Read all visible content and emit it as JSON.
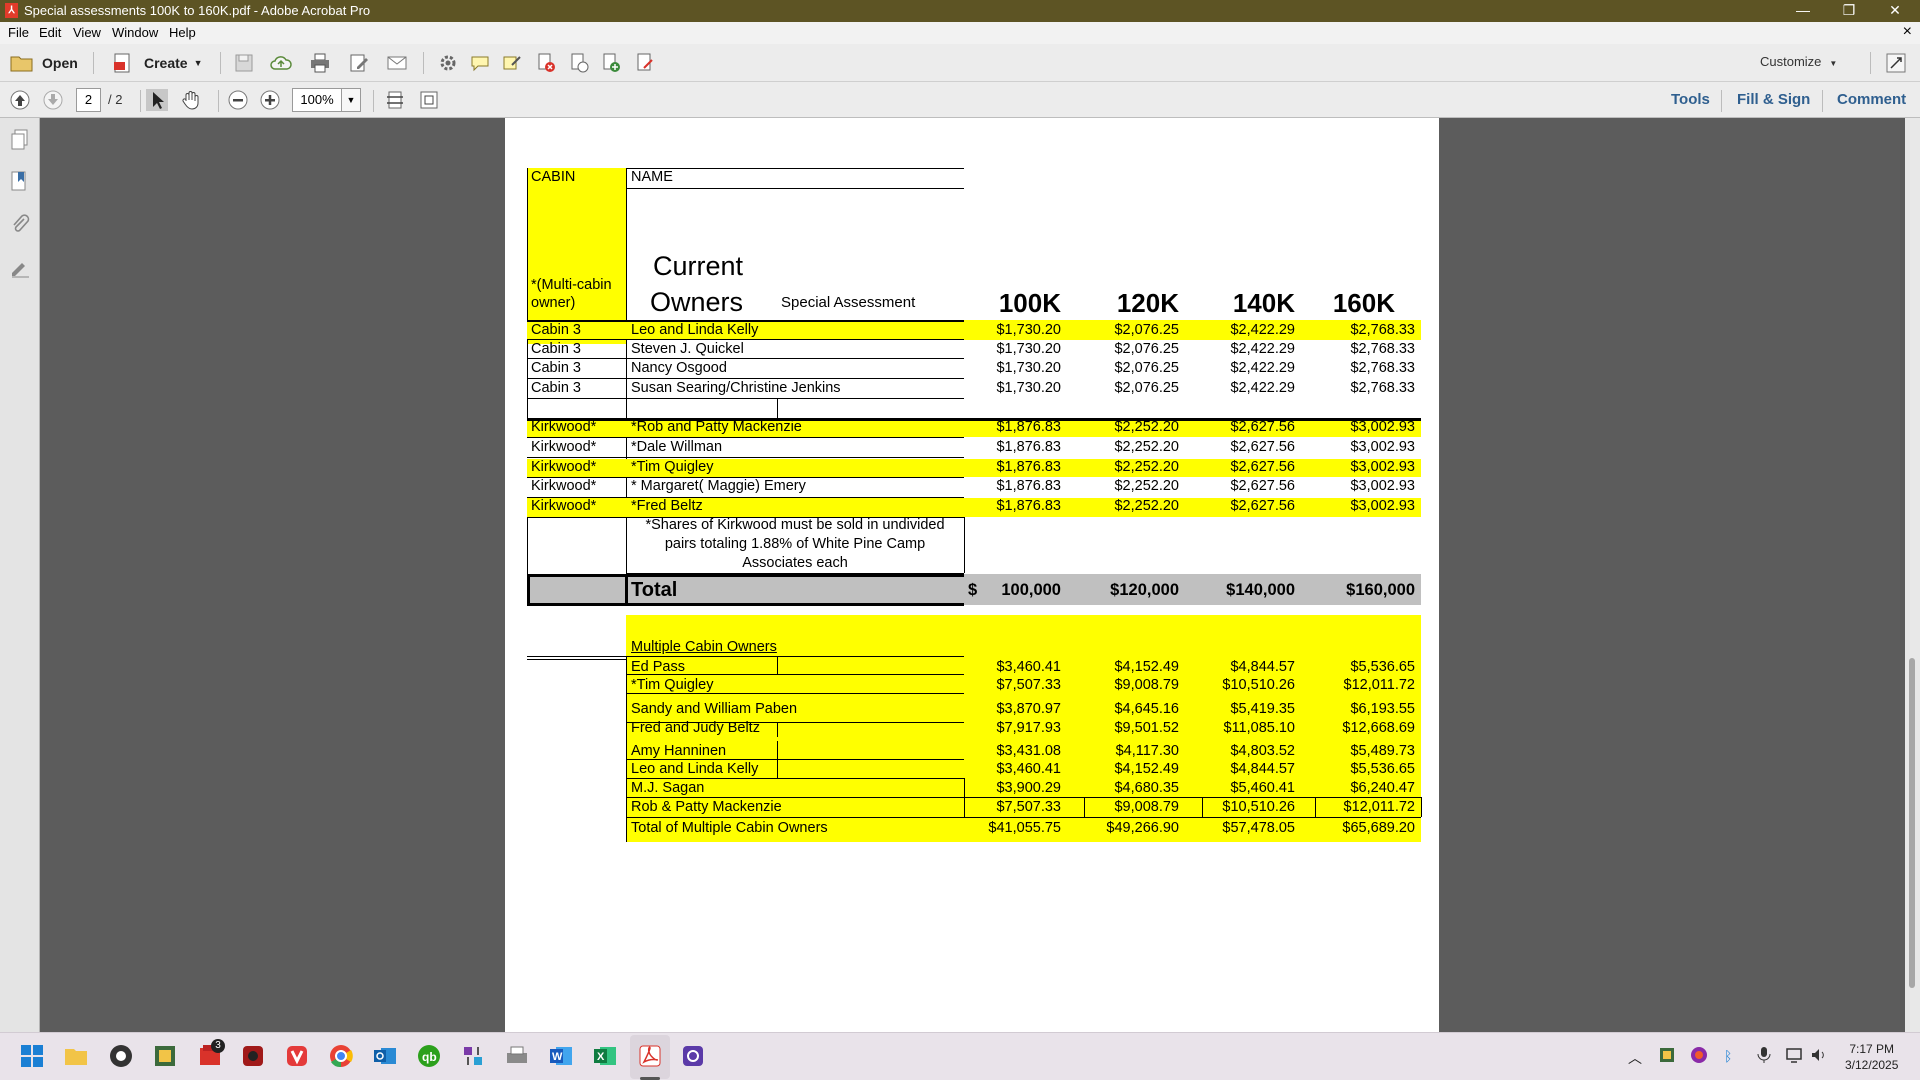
{
  "window": {
    "title": "Special assessments 100K to 160K.pdf - Adobe Acrobat Pro",
    "app_icon": "acrobat-icon",
    "controls": {
      "minimize": "—",
      "restore": "❐",
      "close": "✕"
    }
  },
  "menu": {
    "items": [
      "File",
      "Edit",
      "View",
      "Window",
      "Help"
    ],
    "close_doc": "×"
  },
  "toolbar": {
    "open_label": "Open",
    "create_label": "Create",
    "customize_label": "Customize"
  },
  "nav": {
    "current_page": "2",
    "page_count": "/ 2",
    "zoom": "100%",
    "tools_label": "Tools",
    "fill_sign_label": "Fill & Sign",
    "comment_label": "Comment"
  },
  "sheet": {
    "hdr_cabin": "CABIN",
    "hdr_name": "NAME",
    "multi_note_1": "*(Multi-cabin",
    "multi_note_2": "owner)",
    "current_1": "Current",
    "current_2": "Owners",
    "special_assessment": "Special Assessment",
    "columns": [
      "100K",
      "120K",
      "140K",
      "160K"
    ],
    "cabin3_rows": [
      {
        "cabin": "Cabin 3",
        "name": "Leo and Linda Kelly",
        "v": [
          "$1,730.20",
          "$2,076.25",
          "$2,422.29",
          "$2,768.33"
        ]
      },
      {
        "cabin": "Cabin 3",
        "name": "Steven J. Quickel",
        "v": [
          "$1,730.20",
          "$2,076.25",
          "$2,422.29",
          "$2,768.33"
        ]
      },
      {
        "cabin": "Cabin 3",
        "name": "Nancy Osgood",
        "v": [
          "$1,730.20",
          "$2,076.25",
          "$2,422.29",
          "$2,768.33"
        ]
      },
      {
        "cabin": "Cabin 3",
        "name": "Susan Searing/Christine Jenkins",
        "v": [
          "$1,730.20",
          "$2,076.25",
          "$2,422.29",
          "$2,768.33"
        ]
      }
    ],
    "kirkwood_rows": [
      {
        "cabin": "Kirkwood*",
        "name": "*Rob and Patty Mackenzie",
        "v": [
          "$1,876.83",
          "$2,252.20",
          "$2,627.56",
          "$3,002.93"
        ]
      },
      {
        "cabin": "Kirkwood*",
        "name": "*Dale Willman",
        "v": [
          "$1,876.83",
          "$2,252.20",
          "$2,627.56",
          "$3,002.93"
        ]
      },
      {
        "cabin": "Kirkwood*",
        "name": "*Tim Quigley",
        "v": [
          "$1,876.83",
          "$2,252.20",
          "$2,627.56",
          "$3,002.93"
        ]
      },
      {
        "cabin": "Kirkwood*",
        "name": "* Margaret( Maggie)  Emery",
        "v": [
          "$1,876.83",
          "$2,252.20",
          "$2,627.56",
          "$3,002.93"
        ]
      },
      {
        "cabin": "Kirkwood*",
        "name": "*Fred Beltz",
        "v": [
          "$1,876.83",
          "$2,252.20",
          "$2,627.56",
          "$3,002.93"
        ]
      }
    ],
    "kirkwood_note": [
      "*Shares of Kirkwood must be sold in undivided",
      "pairs totaling 1.88% of White Pine Camp",
      "Associates each"
    ],
    "total_label": "Total",
    "total_dollar": "$",
    "totals": [
      "100,000",
      "$120,000",
      "$140,000",
      "$160,000"
    ],
    "multi_title": "Multiple Cabin Owners",
    "multi_rows": [
      {
        "name": "Ed Pass",
        "v": [
          "$3,460.41",
          "$4,152.49",
          "$4,844.57",
          "$5,536.65"
        ]
      },
      {
        "name": "*Tim Quigley",
        "v": [
          "$7,507.33",
          "$9,008.79",
          "$10,510.26",
          "$12,011.72"
        ]
      },
      {
        "name": "Sandy and William Paben",
        "v": [
          "$3,870.97",
          "$4,645.16",
          "$5,419.35",
          "$6,193.55"
        ]
      },
      {
        "name": "Fred and Judy Beltz",
        "v": [
          "$7,917.93",
          "$9,501.52",
          "$11,085.10",
          "$12,668.69"
        ]
      },
      {
        "name": "Amy Hanninen",
        "v": [
          "$3,431.08",
          "$4,117.30",
          "$4,803.52",
          "$5,489.73"
        ]
      },
      {
        "name": "Leo and Linda Kelly",
        "v": [
          "$3,460.41",
          "$4,152.49",
          "$4,844.57",
          "$5,536.65"
        ]
      },
      {
        "name": "M.J. Sagan",
        "v": [
          "$3,900.29",
          "$4,680.35",
          "$5,460.41",
          "$6,240.47"
        ]
      },
      {
        "name": "Rob & Patty Mackenzie",
        "v": [
          "$7,507.33",
          "$9,008.79",
          "$10,510.26",
          "$12,011.72"
        ]
      }
    ],
    "multi_total_label": "Total of Multiple Cabin Owners",
    "multi_totals": [
      "$41,055.75",
      "$49,266.90",
      "$57,478.05",
      "$65,689.20"
    ]
  },
  "taskbar": {
    "clock_time": "7:17 PM",
    "clock_date": "3/12/2025",
    "badge": "3"
  },
  "colors": {
    "highlight": "#ffff00",
    "total_gray": "#c0c0c0",
    "titlebar": "#5d5424"
  }
}
